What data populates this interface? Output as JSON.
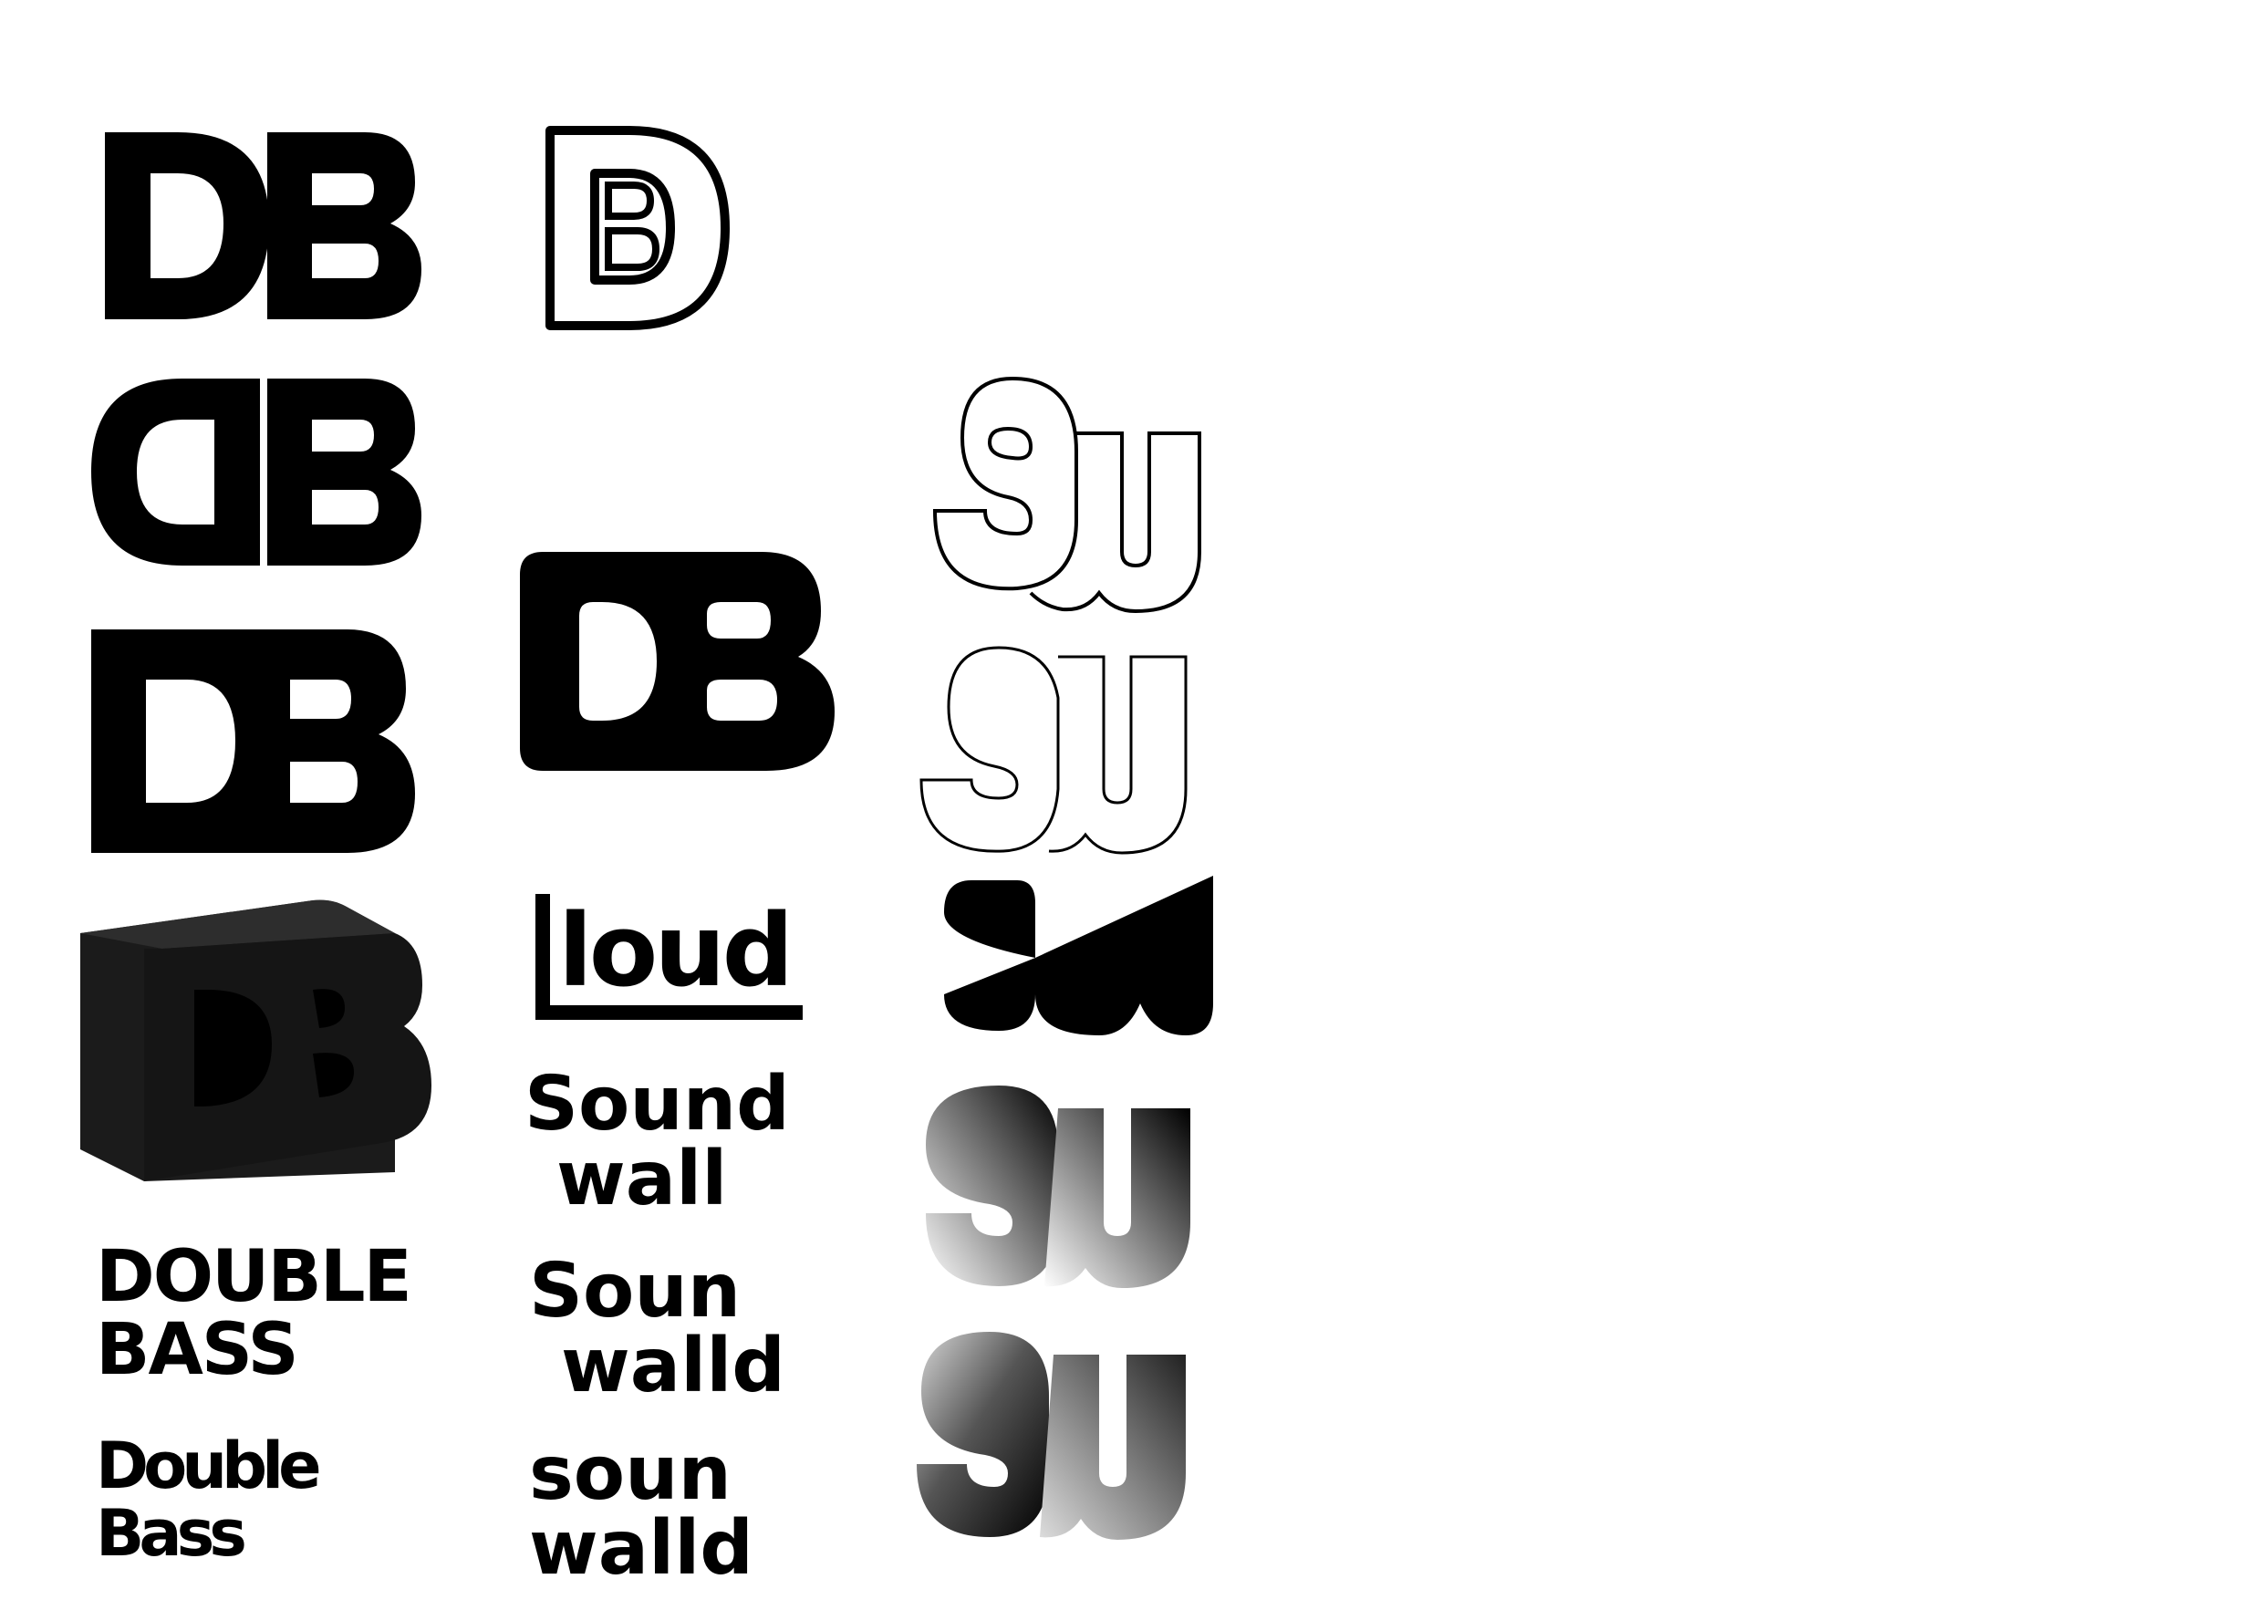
{
  "logos": {
    "db_solid_1": "DB",
    "db_outline": "DB",
    "db_rounded_1": "DB",
    "db_block": "DB",
    "db_block_rounded": "DB",
    "db_3d": "DB",
    "double_bass_caps": [
      "DOUBLE",
      "BASS"
    ],
    "double_bass_mixed": [
      "Double",
      "Bass"
    ],
    "loud": "loud",
    "soundwall_1": [
      "Sound",
      "wall"
    ],
    "soundwall_2": [
      "Soun",
      "walld"
    ],
    "soundwall_3": [
      "soun",
      "walld"
    ],
    "sw_outline_1": "SW",
    "sw_outline_2": "SW",
    "sw_solid_geo": "SW",
    "sw_gradient_1": "SW",
    "sw_gradient_2": "SW"
  },
  "colors": {
    "ink": "#000000",
    "paper": "#ffffff",
    "shade_dark": "#1b1b1b",
    "shade_mid": "#2d2d2d",
    "gradient_light": "#d9d9d9"
  }
}
